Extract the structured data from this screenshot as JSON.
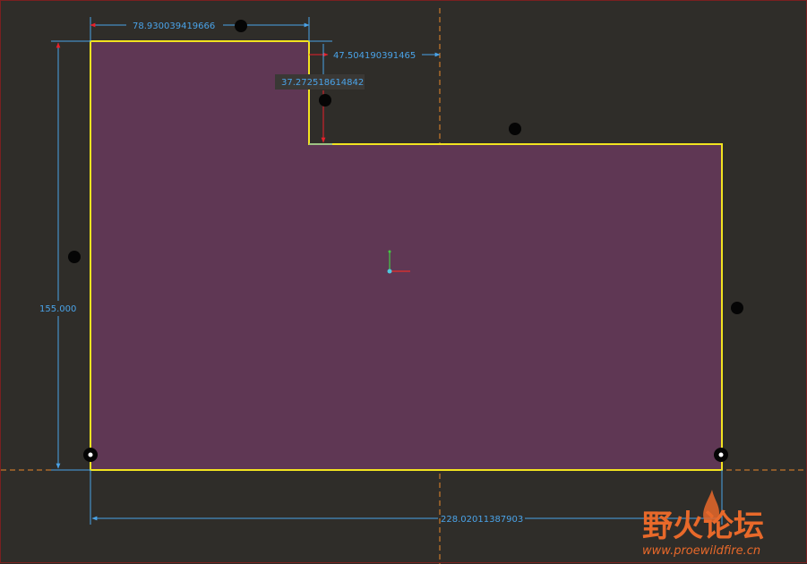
{
  "sketch": {
    "dimensions": {
      "top_width": "78.930039419666",
      "step_offset": "47.504190391465",
      "step_height": "37.272518614842",
      "height": "155.000",
      "overall_width": "228.02011387903"
    },
    "colors": {
      "background": "#2f2d29",
      "profile_fill": "#5f3754",
      "profile_edge": "#f2e320",
      "dimension": "#4aa3e8",
      "dimension_arrow": "#e8202a",
      "centerline": "#e8892a",
      "handle": "#050505"
    }
  },
  "watermark": {
    "title": "野火论坛",
    "url": "www.proewildfire.cn"
  }
}
